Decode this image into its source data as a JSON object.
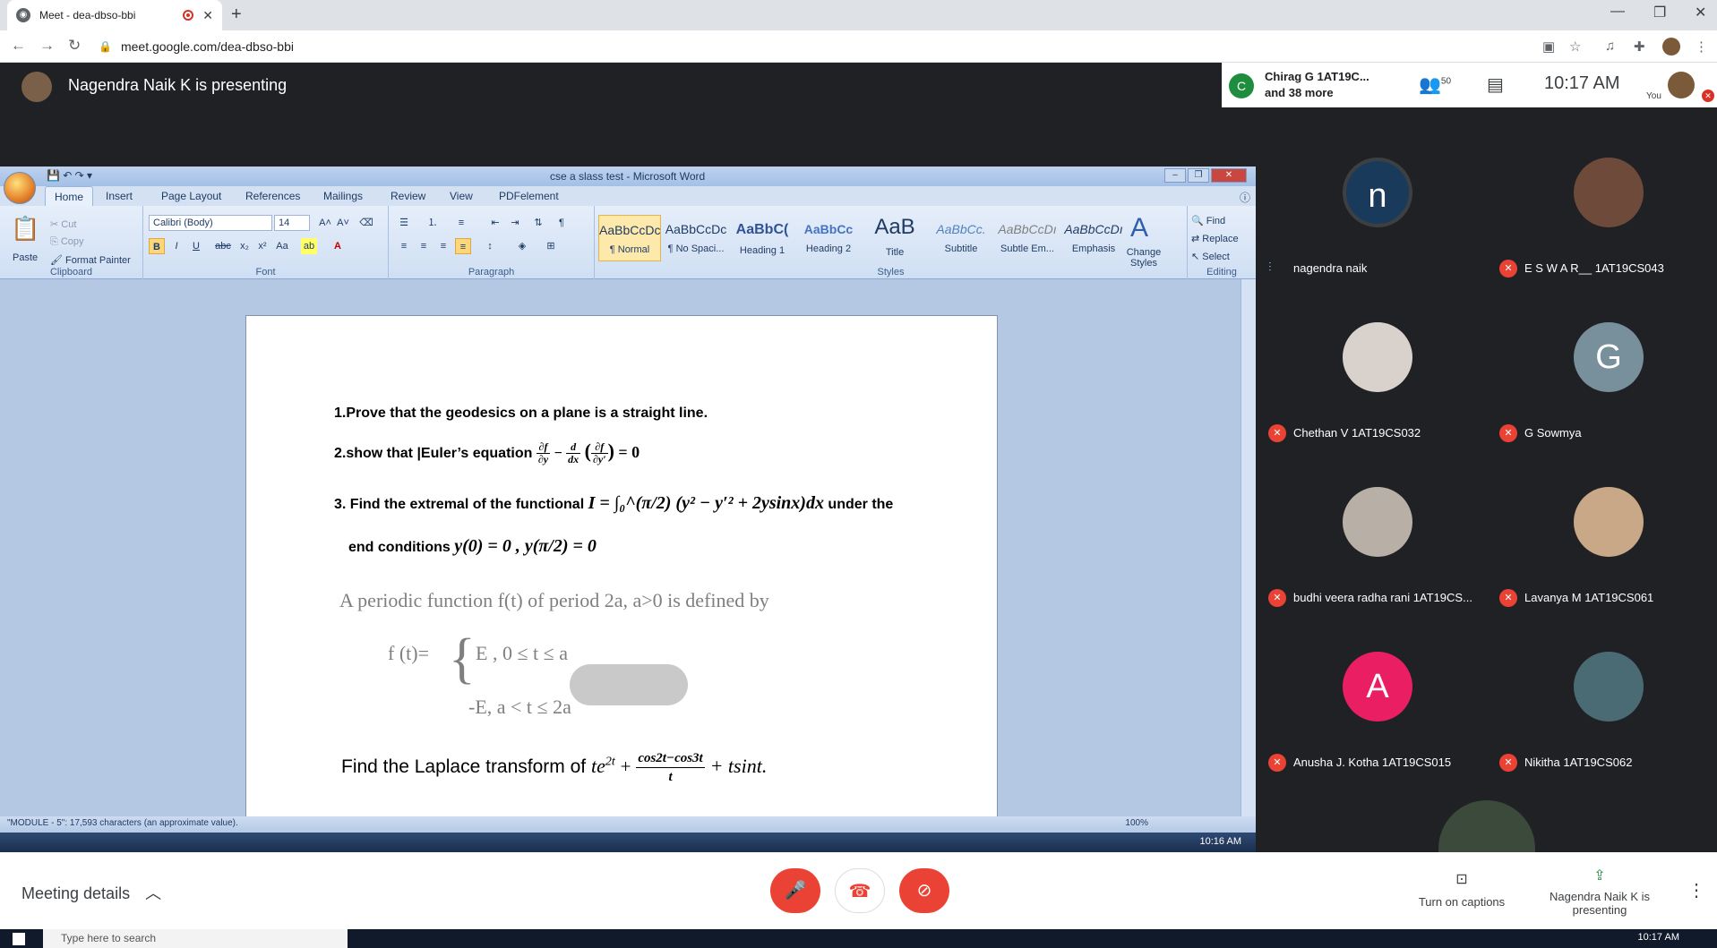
{
  "browser": {
    "tab_title": "Meet - dea-dbso-bbi",
    "url": "meet.google.com/dea-dbso-bbi"
  },
  "meet": {
    "presenting_title": "Nagendra Naik K is presenting",
    "chip_name": "Chirag G 1AT19C...",
    "chip_more": "and 38 more",
    "chip_initial": "C",
    "people_count": "50",
    "time": "10:17 AM",
    "you_label": "You"
  },
  "word": {
    "window_title": "cse a slass test - Microsoft Word",
    "tabs": [
      "Home",
      "Insert",
      "Page Layout",
      "References",
      "Mailings",
      "Review",
      "View",
      "PDFelement"
    ],
    "clipboard": {
      "paste": "Paste",
      "cut": "Cut",
      "copy": "Copy",
      "format_painter": "Format Painter",
      "label": "Clipboard"
    },
    "font": {
      "name": "Calibri (Body)",
      "size": "14",
      "label": "Font"
    },
    "paragraph_label": "Paragraph",
    "styles": [
      {
        "sample": "AaBbCcDc",
        "label": "¶ Normal"
      },
      {
        "sample": "AaBbCcDc",
        "label": "¶ No Spaci..."
      },
      {
        "sample": "AaBbC(",
        "label": "Heading 1"
      },
      {
        "sample": "AaBbCc",
        "label": "Heading 2"
      },
      {
        "sample": "AaB",
        "label": "Title"
      },
      {
        "sample": "AaBbCc.",
        "label": "Subtitle"
      },
      {
        "sample": "AaBbCcDı",
        "label": "Subtle Em..."
      },
      {
        "sample": "AaBbCcDı",
        "label": "Emphasis"
      }
    ],
    "styles_label": "Styles",
    "change_styles": "Change Styles",
    "editing": {
      "find": "Find",
      "replace": "Replace",
      "select": "Select",
      "label": "Editing"
    },
    "doc": {
      "q1": "1.Prove that the geodesics on a plane is a straight line.",
      "q2_prefix": "2.show that |Euler’s equation",
      "q2_eq_tail": "= 0",
      "q3_prefix": "3. Find the extremal of the functional",
      "q3_math": "I = ∫₀^(π/2) (y² − y′² + 2ysinx)dx",
      "q3_suffix": "under the",
      "q3_line2_prefix": "end conditions",
      "q3_line2_math": "y(0) = 0 , y(π/2) = 0",
      "q4_line1": "A periodic function f(t) of period 2a,  a>0 is defined by",
      "q4_f": "f (t)=",
      "q4_case1": "E ,  0 ≤ t ≤ a",
      "q4_case2": "-E, a < t ≤ 2a",
      "q5_prefix": "Find the Laplace transform of",
      "q5_math_a": "te",
      "q5_math_a_sup": "2t",
      "q5_frac_num": "cos2t−cos3t",
      "q5_frac_den": "t",
      "q5_math_tail": "+ tsint."
    },
    "status_text": "\"MODULE - 5\": 17,593 characters (an approximate value).",
    "zoom": "100%",
    "taskbar_time": "10:16 AM"
  },
  "participants": [
    {
      "name": "nagendra naik",
      "initial": "n",
      "color": "#1a3a5c",
      "muted": false
    },
    {
      "name": "E S W A R__ 1AT19CS043",
      "initial": "",
      "color": "#6d4a3a",
      "muted": true
    },
    {
      "name": "Chethan V 1AT19CS032",
      "initial": "",
      "color": "#d9d2cc",
      "muted": true
    },
    {
      "name": "G Sowmya",
      "initial": "G",
      "color": "#78909c",
      "muted": true
    },
    {
      "name": "budhi veera radha rani 1AT19CS...",
      "initial": "",
      "color": "#b8b0a6",
      "muted": true
    },
    {
      "name": "Lavanya M 1AT19CS061",
      "initial": "",
      "color": "#c9a887",
      "muted": true
    },
    {
      "name": "Anusha J. Kotha 1AT19CS015",
      "initial": "A",
      "color": "#e91e63",
      "muted": true
    },
    {
      "name": "Nikitha 1AT19CS062",
      "initial": "",
      "color": "#4b6b74",
      "muted": true
    }
  ],
  "bottom": {
    "meeting_details": "Meeting details",
    "captions": "Turn on captions",
    "presenting": "Nagendra Naik K is presenting"
  },
  "windows": {
    "search_placeholder": "Type here to search",
    "time": "10:17 AM"
  }
}
